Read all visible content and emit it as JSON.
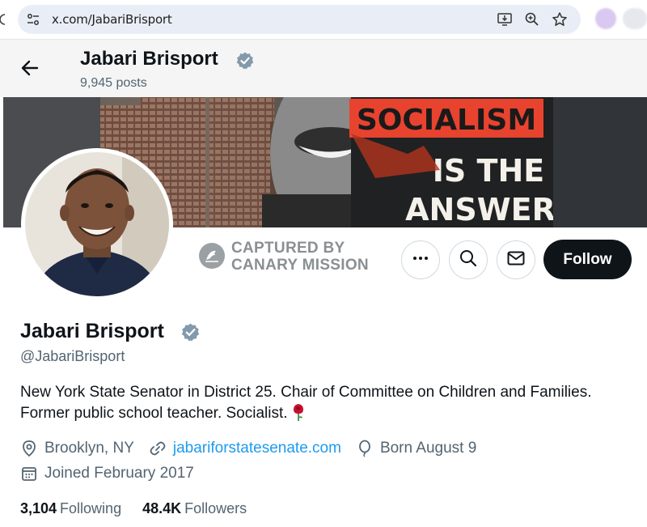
{
  "browser": {
    "url": "x.com/JabariBrisport",
    "icons": [
      "site-info-icon",
      "install-app-icon",
      "zoom-icon",
      "bookmark-star-icon"
    ]
  },
  "header": {
    "name": "Jabari Brisport",
    "posts": "9,945 posts",
    "verified": true
  },
  "banner": {
    "line1": "SOCIALISM",
    "line2": "IS THE",
    "line3": "ANSWER",
    "accent": "#e8432f"
  },
  "watermark": {
    "line1": "CAPTURED BY",
    "line2": "CANARY MISSION"
  },
  "actions": {
    "more_icon": "more-icon",
    "search_icon": "search-icon",
    "message_icon": "message-icon",
    "follow_label": "Follow"
  },
  "profile": {
    "name": "Jabari Brisport",
    "handle": "@JabariBrisport",
    "bio": "New York State Senator in District 25. Chair of Committee on Children and Families. Former public school teacher. Socialist.",
    "location": "Brooklyn, NY",
    "website": "jabariforstatesenate.com",
    "birthday": "Born August 9",
    "joined": "Joined February 2017",
    "following_count": "3,104",
    "following_label": "Following",
    "followers_count": "48.4K",
    "followers_label": "Followers"
  },
  "colors": {
    "verified_badge": "#829aab",
    "link": "#1d9bf0",
    "follow_button": "#0f1419",
    "secondary_text": "#536471"
  }
}
